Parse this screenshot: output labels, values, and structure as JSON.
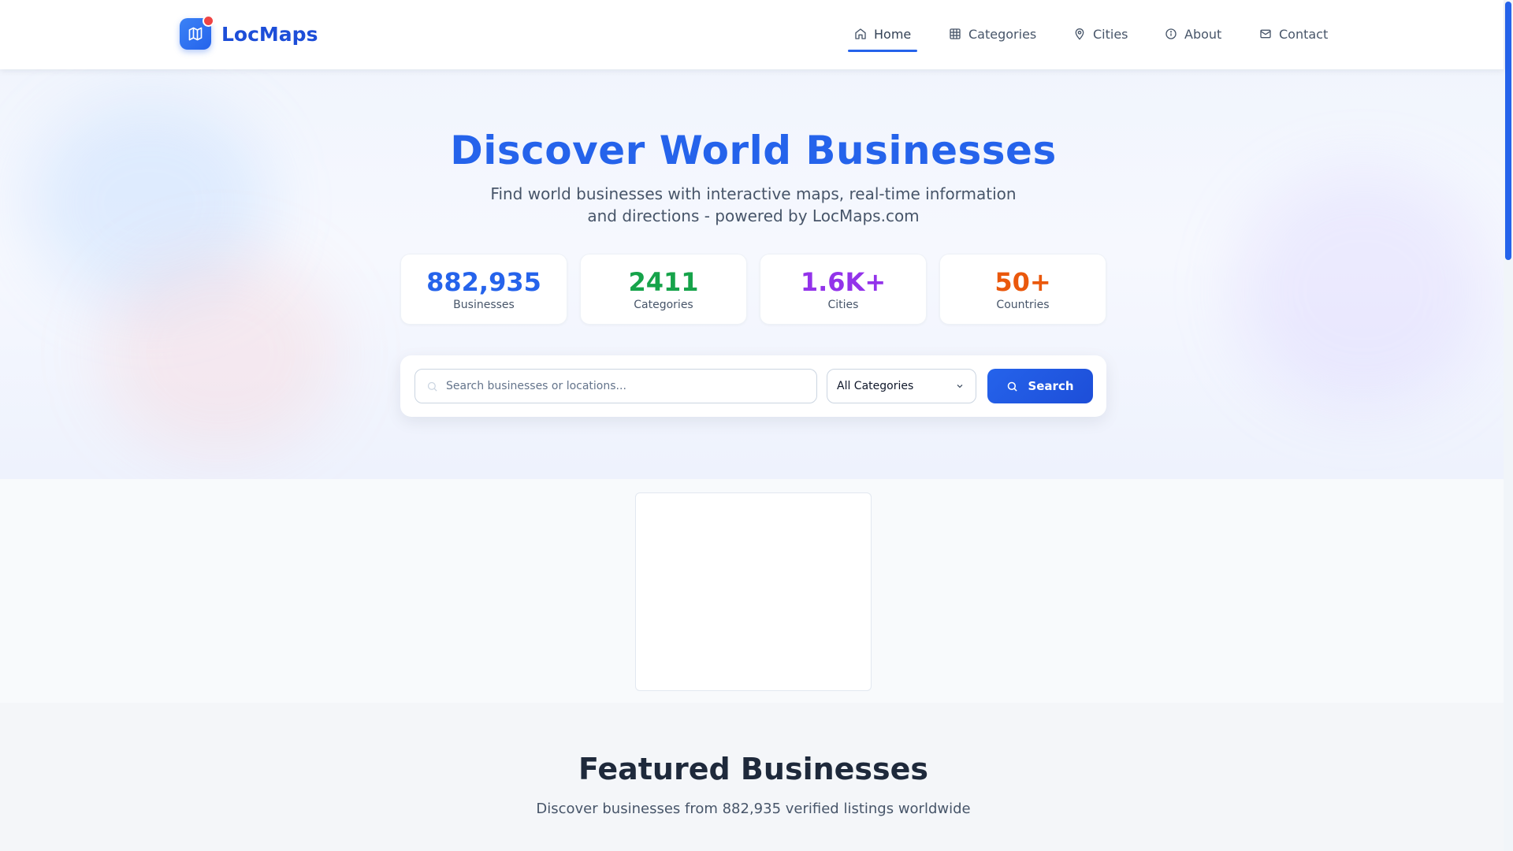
{
  "brand": {
    "name": "LocMaps"
  },
  "nav": {
    "home": "Home",
    "categories": "Categories",
    "cities": "Cities",
    "about": "About",
    "contact": "Contact"
  },
  "hero": {
    "title": "Discover World Businesses",
    "subtitle": "Find world businesses with interactive maps, real-time information and directions - powered by LocMaps.com"
  },
  "stats": [
    {
      "value": "882,935",
      "label": "Businesses",
      "color": "#2563eb"
    },
    {
      "value": "2411",
      "label": "Categories",
      "color": "#16a34a"
    },
    {
      "value": "1.6K+",
      "label": "Cities",
      "color": "#9333ea"
    },
    {
      "value": "50+",
      "label": "Countries",
      "color": "#ea580c"
    }
  ],
  "search": {
    "placeholder": "Search businesses or locations...",
    "category_selected": "All Categories",
    "button_label": "Search"
  },
  "featured": {
    "title": "Featured Businesses",
    "subtitle": "Discover businesses from 882,935 verified listings worldwide"
  },
  "colors": {
    "accent": "#2563eb",
    "logo_badge": "#ef4444"
  }
}
